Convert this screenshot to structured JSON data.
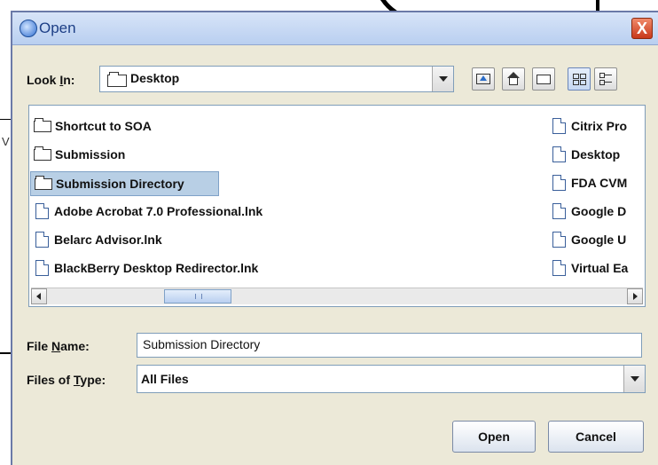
{
  "window": {
    "title": "Open",
    "close_label": "X"
  },
  "background": {
    "side_text": "V"
  },
  "look_in": {
    "label_prefix": "Look ",
    "label_mnemonic": "I",
    "label_suffix": "n:",
    "value": "Desktop"
  },
  "toolbar": {
    "icons": [
      "up-folder-icon",
      "home-icon",
      "new-folder-icon",
      "list-view-icon",
      "details-view-icon"
    ]
  },
  "files": {
    "left_column": [
      {
        "name": "Shortcut to SOA",
        "type": "folder"
      },
      {
        "name": "Submission",
        "type": "folder"
      },
      {
        "name": "Submission Directory",
        "type": "folder",
        "selected": true
      },
      {
        "name": "Adobe Acrobat 7.0 Professional.lnk",
        "type": "file"
      },
      {
        "name": "Belarc Advisor.lnk",
        "type": "file"
      },
      {
        "name": "BlackBerry Desktop Redirector.lnk",
        "type": "file"
      }
    ],
    "right_column": [
      {
        "name": "Citrix Pro",
        "type": "file"
      },
      {
        "name": "Desktop",
        "type": "file"
      },
      {
        "name": "FDA CVM",
        "type": "file"
      },
      {
        "name": "Google D",
        "type": "file"
      },
      {
        "name": "Google U",
        "type": "file"
      },
      {
        "name": "Virtual Ea",
        "type": "file"
      }
    ]
  },
  "file_name": {
    "label_prefix": "File ",
    "label_mnemonic": "N",
    "label_suffix": "ame:",
    "value": "Submission Directory"
  },
  "files_of_type": {
    "label_prefix": "Files of ",
    "label_mnemonic": "T",
    "label_suffix": "ype:",
    "value": "All Files"
  },
  "buttons": {
    "open": "Open",
    "cancel": "Cancel"
  },
  "colors": {
    "dialog_bg": "#ece9d8",
    "title_text": "#1d3f86",
    "selection": "#b8cfe5"
  }
}
